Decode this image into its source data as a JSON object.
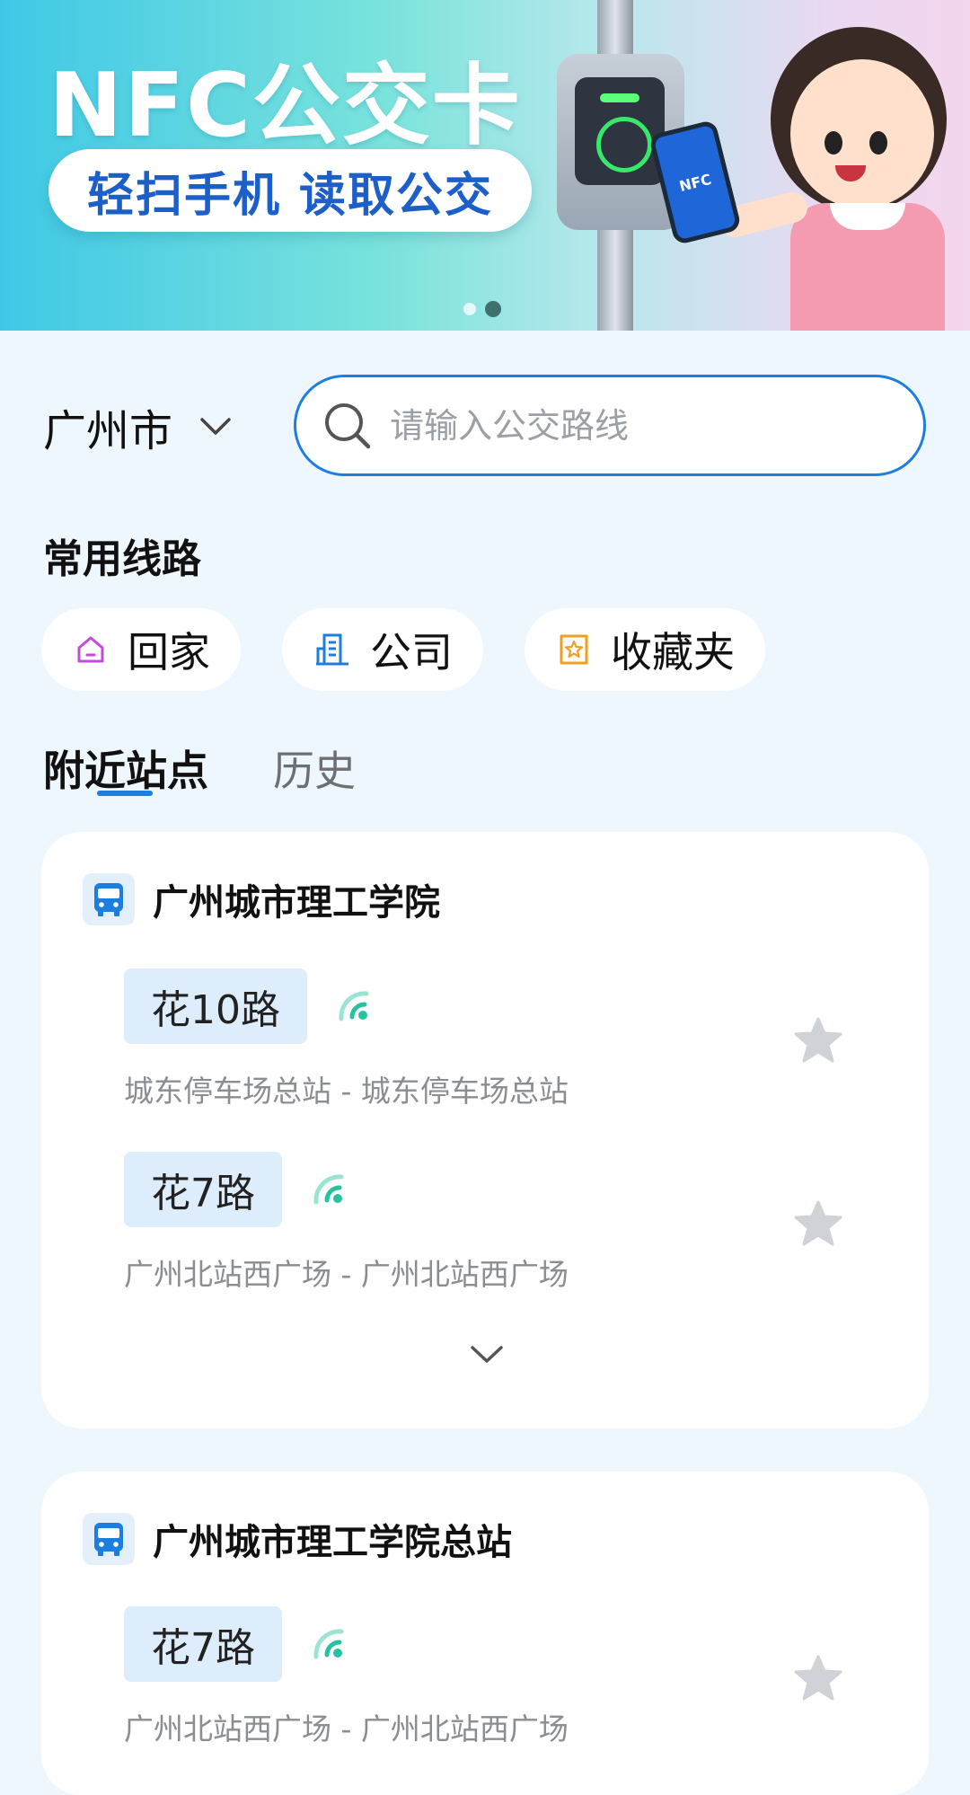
{
  "banner": {
    "title": "NFC公交卡",
    "subtitle": "轻扫手机 读取公交",
    "phone_label": "NFC",
    "carousel": {
      "count": 2,
      "active_index": 1
    }
  },
  "city": {
    "label": "广州市",
    "icon": "chevron-down-icon"
  },
  "search": {
    "placeholder": "请输入公交路线",
    "value": "",
    "icon": "search-icon"
  },
  "common_routes": {
    "title": "常用线路",
    "chips": [
      {
        "label": "回家",
        "icon": "home-icon",
        "color": "#C34BD9"
      },
      {
        "label": "公司",
        "icon": "building-icon",
        "color": "#1C7FE0"
      },
      {
        "label": "收藏夹",
        "icon": "star-folder-icon",
        "color": "#F0A020"
      }
    ]
  },
  "tabs": [
    {
      "label": "附近站点",
      "active": true
    },
    {
      "label": "历史",
      "active": false
    }
  ],
  "stations": [
    {
      "name": "广州城市理工学院",
      "routes": [
        {
          "route": "花10路",
          "desc": "城东停车场总站 - 城东停车场总站",
          "favorite": false
        },
        {
          "route": "花7路",
          "desc": "广州北站西广场 - 广州北站西广场",
          "favorite": false
        }
      ]
    },
    {
      "name": "广州城市理工学院总站",
      "routes": [
        {
          "route": "花7路",
          "desc": "广州北站西广场 - 广州北站西广场",
          "favorite": false
        }
      ]
    }
  ],
  "colors": {
    "accent": "#1C7FE0",
    "signal": "#27C3A0",
    "background": "#EEF6FE"
  }
}
